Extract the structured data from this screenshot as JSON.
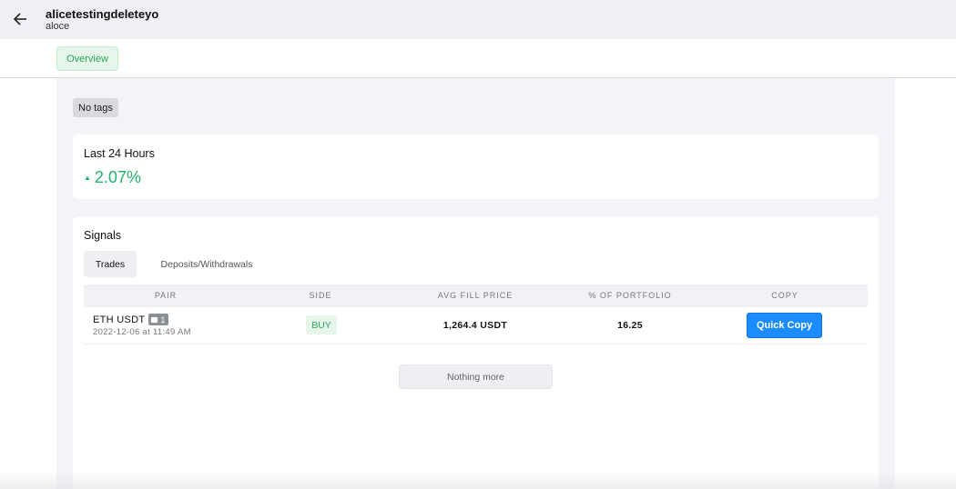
{
  "header": {
    "username": "alicetestingdeleteyo",
    "handle": "aloce",
    "back_icon": "arrow-left-icon"
  },
  "tabs": {
    "overview_label": "Overview"
  },
  "tags": {
    "label": "No tags"
  },
  "last24h": {
    "title": "Last 24 Hours",
    "change": "2.07%",
    "color": "#1fb36a"
  },
  "signals": {
    "title": "Signals",
    "subtabs": {
      "trades": "Trades",
      "deposits": "Deposits/Withdrawals"
    },
    "columns": {
      "pair": "PAIR",
      "side": "SIDE",
      "avg_fill_price": "AVG FILL PRICE",
      "pct_portfolio": "% OF PORTFOLIO",
      "copy": "COPY"
    },
    "rows": [
      {
        "pair": "ETH USDT",
        "comments": "1",
        "date": "2022-12-06 at 11:49 AM",
        "side": "BUY",
        "avg_fill_price": "1,264.4 USDT",
        "pct_portfolio": "16.25",
        "copy_label": "Quick Copy"
      }
    ],
    "nothing_more": "Nothing more"
  },
  "colors": {
    "accent_green": "#2ca55a",
    "button_blue": "#1a8cff"
  }
}
